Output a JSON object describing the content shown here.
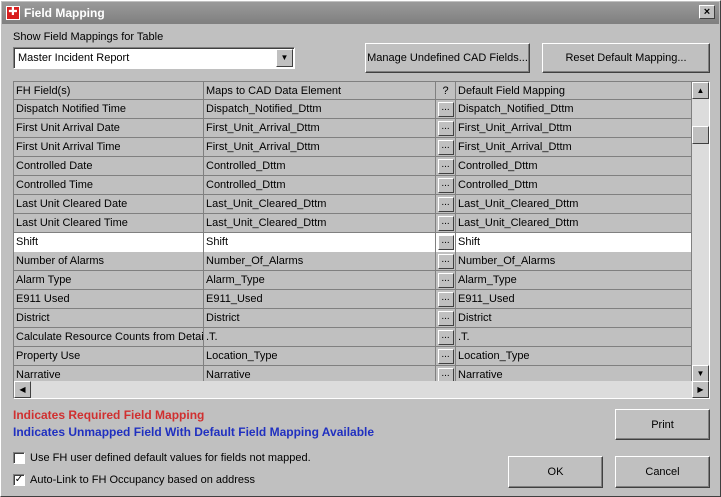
{
  "window": {
    "title": "Field Mapping",
    "close_glyph": "×"
  },
  "table_selector": {
    "label": "Show Field Mappings for Table",
    "selected": "Master Incident Report"
  },
  "buttons": {
    "manage_undefined": "Manage Undefined CAD Fields...",
    "reset_default": "Reset Default Mapping...",
    "print": "Print",
    "ok": "OK",
    "cancel": "Cancel"
  },
  "grid": {
    "columns": [
      "FH Field(s)",
      "Maps to CAD Data Element",
      "?",
      "Default Field Mapping"
    ],
    "rows": [
      {
        "fh": "Dispatch Notified Time",
        "cad": "Dispatch_Notified_Dttm",
        "default": "Dispatch_Notified_Dttm"
      },
      {
        "fh": "First Unit Arrival Date",
        "cad": "First_Unit_Arrival_Dttm",
        "default": "First_Unit_Arrival_Dttm"
      },
      {
        "fh": "First Unit Arrival Time",
        "cad": "First_Unit_Arrival_Dttm",
        "default": "First_Unit_Arrival_Dttm"
      },
      {
        "fh": "Controlled Date",
        "cad": "Controlled_Dttm",
        "default": "Controlled_Dttm"
      },
      {
        "fh": "Controlled Time",
        "cad": "Controlled_Dttm",
        "default": "Controlled_Dttm"
      },
      {
        "fh": "Last Unit Cleared Date",
        "cad": "Last_Unit_Cleared_Dttm",
        "default": "Last_Unit_Cleared_Dttm"
      },
      {
        "fh": "Last Unit Cleared Time",
        "cad": "Last_Unit_Cleared_Dttm",
        "default": "Last_Unit_Cleared_Dttm"
      },
      {
        "fh": "Shift",
        "cad": "Shift",
        "default": "Shift",
        "selected": true
      },
      {
        "fh": "Number of Alarms",
        "cad": "Number_Of_Alarms",
        "default": "Number_Of_Alarms"
      },
      {
        "fh": "Alarm Type",
        "cad": "Alarm_Type",
        "default": "Alarm_Type"
      },
      {
        "fh": "E911 Used",
        "cad": "E911_Used",
        "default": "E911_Used"
      },
      {
        "fh": "District",
        "cad": "District",
        "default": "District"
      },
      {
        "fh": "Calculate Resource Counts from Detail I",
        "cad": ".T.",
        "default": ".T."
      },
      {
        "fh": "Property Use",
        "cad": "Location_Type",
        "default": "Location_Type"
      },
      {
        "fh": "Narrative",
        "cad": "Narrative",
        "default": "Narrative"
      }
    ],
    "ellipsis_label": "..."
  },
  "legend": {
    "required": "Indicates Required Field Mapping",
    "unmapped": "Indicates Unmapped Field With Default Field Mapping Available",
    "required_color": "#d03030",
    "unmapped_color": "#2030c0"
  },
  "options": {
    "use_fh_defaults": {
      "label": "Use FH user defined default values for fields not mapped.",
      "checked": false
    },
    "auto_link": {
      "label": "Auto-Link to FH Occupancy based on address",
      "checked": true
    }
  },
  "check_glyph": "✓"
}
